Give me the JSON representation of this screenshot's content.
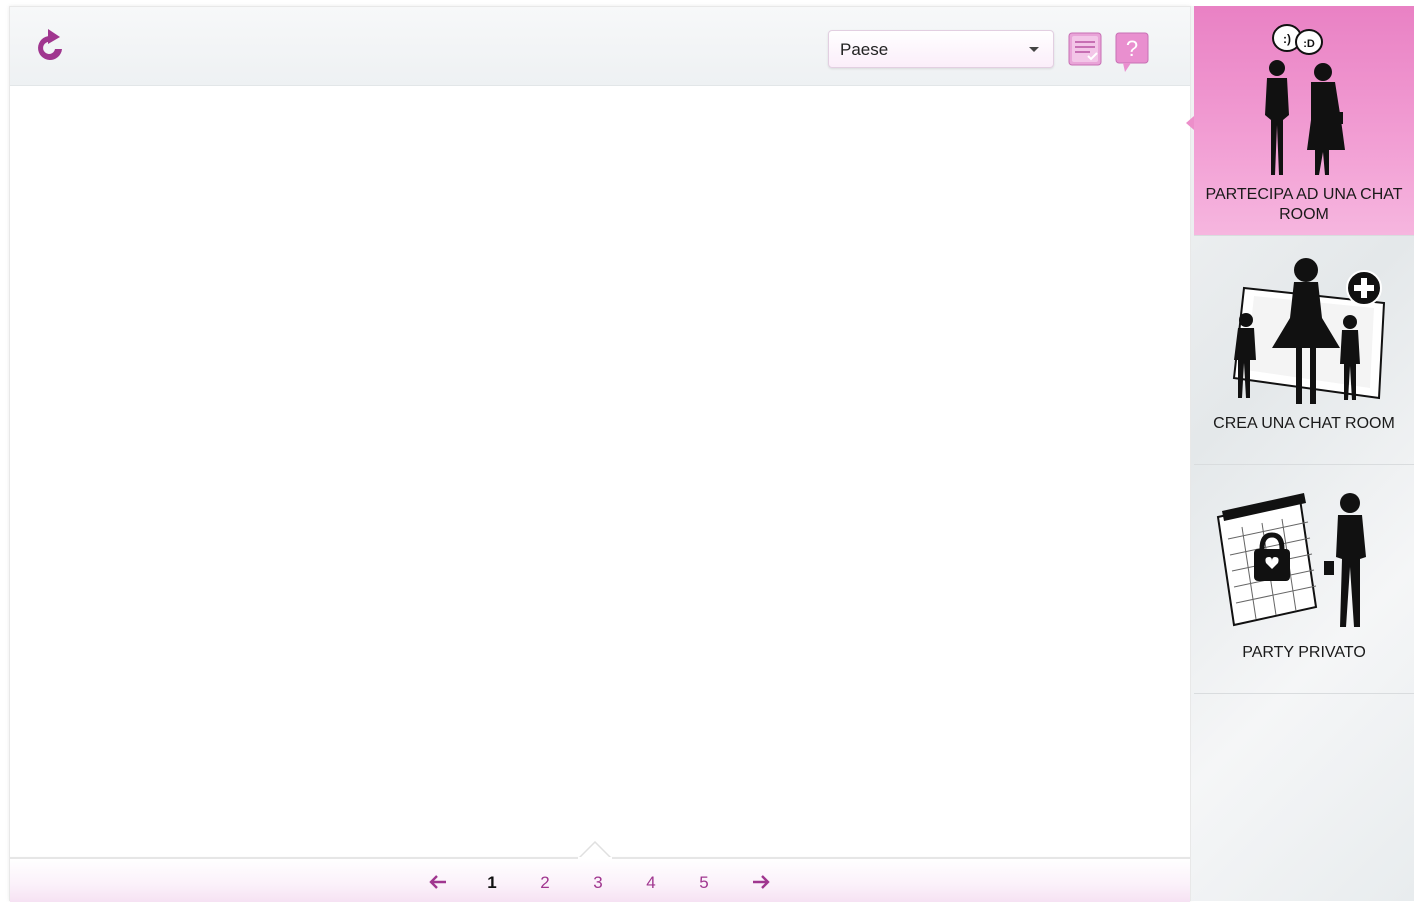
{
  "toolbar": {
    "refresh_icon": "refresh-icon",
    "country_select": {
      "value": "Paese"
    },
    "list_icon": "checklist-icon",
    "help_icon": "help-icon"
  },
  "pagination": {
    "prev_icon": "arrow-left-icon",
    "next_icon": "arrow-right-icon",
    "pages": [
      "1",
      "2",
      "3",
      "4",
      "5"
    ],
    "current": "1"
  },
  "sidebar": {
    "items": [
      {
        "label": "PARTECIPA AD UNA CHAT ROOM",
        "icon": "join-chat-icon",
        "active": true,
        "speech": [
          ":)",
          ":D"
        ]
      },
      {
        "label": "CREA UNA CHAT ROOM",
        "icon": "create-chat-icon",
        "active": false
      },
      {
        "label": "PARTY PRIVATO",
        "icon": "private-party-icon",
        "active": false
      }
    ]
  },
  "colors": {
    "accent": "#a0368f",
    "active_pink": "#ef92cc",
    "icon_purple": "#b64fa6"
  }
}
